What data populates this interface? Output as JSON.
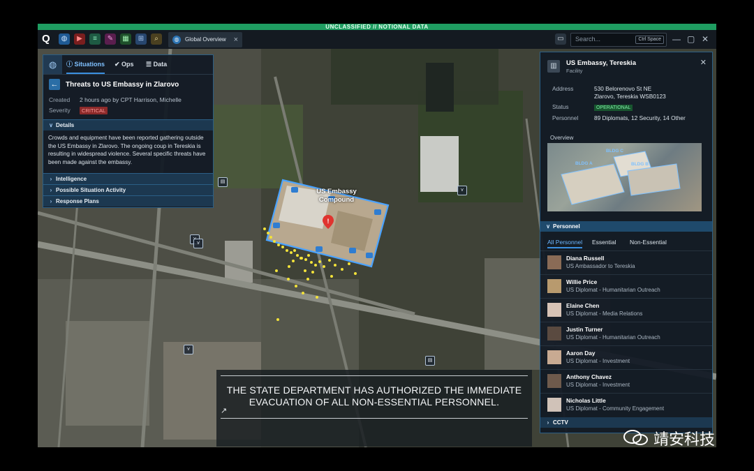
{
  "banner": "UNCLASSIFIED // NOTIONAL DATA",
  "toolbar": {
    "tab_label": "Global Overview",
    "search_placeholder": "Search...",
    "search_shortcut": "Ctrl Space"
  },
  "left_panel": {
    "tabs": [
      "Situations",
      "Ops",
      "Data"
    ],
    "title": "Threats to US Embassy in Zlarovo",
    "created_label": "Created",
    "created_value": "2 hours ago by CPT Harrison, Michelle",
    "severity_label": "Severity",
    "severity_value": "CRITICAL",
    "details_header": "Details",
    "details_text": "Crowds and equipment have been reported gathering outside the US Embassy in Zlarovo. The ongoing coup in Tereskia is resulting in widespread violence. Several specific threats have been made against the embassy.",
    "sections": [
      "Intelligence",
      "Possible Situation Activity",
      "Response Plans"
    ]
  },
  "map": {
    "label_line1": "US Embassy",
    "label_line2": "Compound"
  },
  "right_panel": {
    "title": "US Embassy, Tereskia",
    "subtitle": "Facility",
    "address_label": "Address",
    "address_line1": "530 Belorenovo St NE",
    "address_line2": "Zlarovo, Tereskia   WSB0123",
    "status_label": "Status",
    "status_value": "OPERATIONAL",
    "personnel_label": "Personnel",
    "personnel_value": "89 Diplomats, 12 Security, 14 Other",
    "overview_label": "Overview",
    "overview_buildings": [
      "BLDG A",
      "BLDG B",
      "BLDG C"
    ],
    "personnel_header": "Personnel",
    "personnel_tabs": [
      "All Personnel",
      "Essential",
      "Non-Essential"
    ],
    "people": [
      {
        "name": "Diana Russell",
        "role": "US Ambassador to Tereskia"
      },
      {
        "name": "Willie Price",
        "role": "US Diplomat - Humanitarian Outreach"
      },
      {
        "name": "Elaine Chen",
        "role": "US Diplomat - Media Relations"
      },
      {
        "name": "Justin Turner",
        "role": "US Diplomat - Humanitarian Outreach"
      },
      {
        "name": "Aaron Day",
        "role": "US Diplomat - Investment"
      },
      {
        "name": "Anthony Chavez",
        "role": "US Diplomat - Investment"
      },
      {
        "name": "Nicholas Little",
        "role": "US Diplomat - Community Engagement"
      }
    ],
    "cctv_header": "CCTV"
  },
  "caption": "THE STATE DEPARTMENT HAS AUTHORIZED THE IMMEDIATE EVACUATION OF ALL NON-ESSENTIAL PERSONNEL.",
  "watermark": "靖安科技",
  "colors": {
    "accent": "#3b8fe0",
    "critical": "#8c2a2a",
    "operational": "#18552f",
    "banner": "#1f9d61",
    "crowd": "#f2e23a"
  }
}
